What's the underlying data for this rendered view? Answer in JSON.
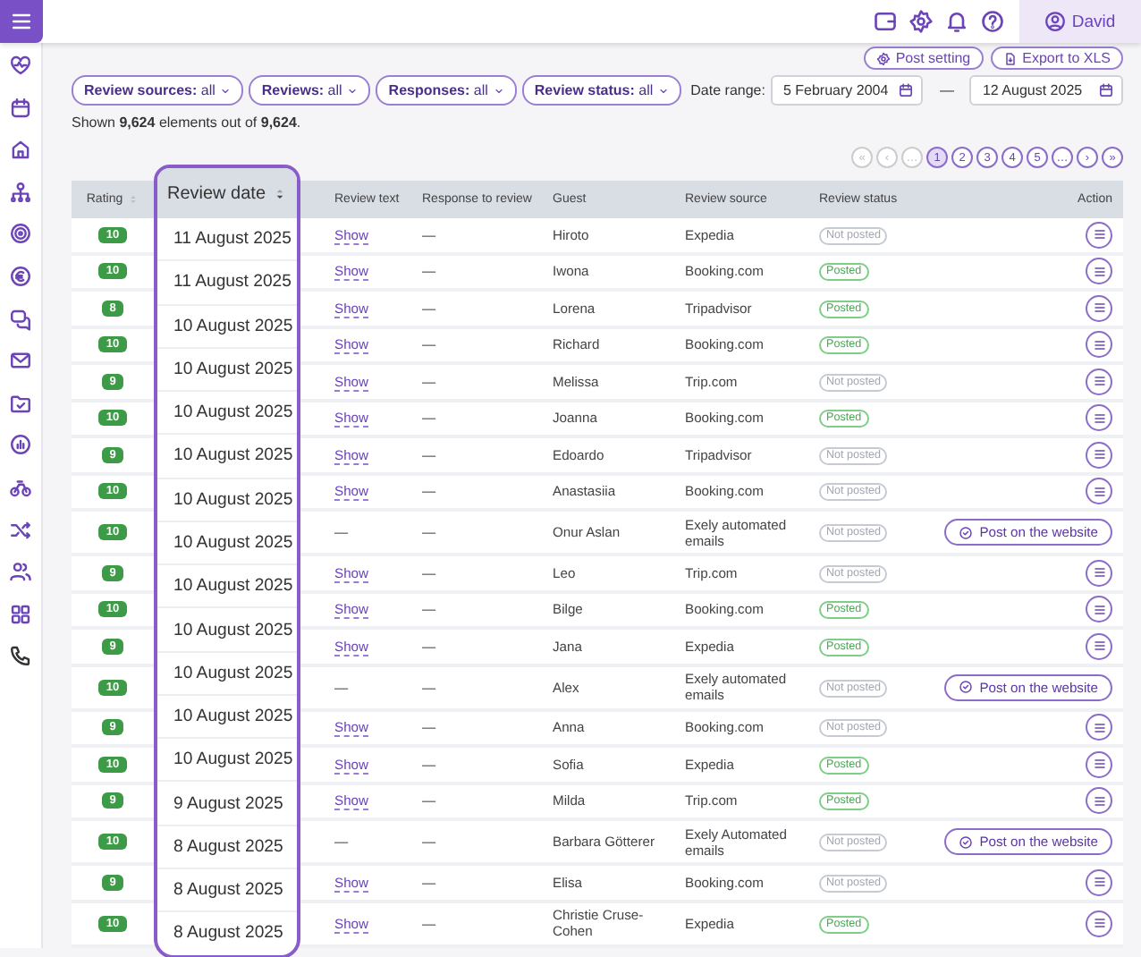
{
  "top_bar": {
    "user": "David"
  },
  "toolbar": {
    "buttons": [
      {
        "label": "Post setting",
        "kind": "settings"
      },
      {
        "label": "Export to XLS",
        "kind": "export"
      }
    ]
  },
  "filters": [
    {
      "label": "**Review sources:** all"
    },
    {
      "label": "**Reviews:** all"
    },
    {
      "label": "**Responses:** all"
    },
    {
      "label": "**Review status:** all"
    }
  ],
  "date_range": {
    "label": "Date range:",
    "from": "5 February 2004",
    "separator": "—",
    "to": "12 August 2025"
  },
  "summary": "Shown **9,624** elements out of **9,624**.",
  "pagination": [
    {
      "label": "«",
      "disabled": true,
      "selected": false
    },
    {
      "label": "‹",
      "disabled": true,
      "selected": false
    },
    {
      "label": "…",
      "disabled": true,
      "selected": false
    },
    {
      "label": "1",
      "disabled": false,
      "selected": true
    },
    {
      "label": "2",
      "disabled": false,
      "selected": false
    },
    {
      "label": "3",
      "disabled": false,
      "selected": false
    },
    {
      "label": "4",
      "disabled": false,
      "selected": false
    },
    {
      "label": "5",
      "disabled": false,
      "selected": false
    },
    {
      "label": "…",
      "disabled": false,
      "selected": false
    },
    {
      "label": "›",
      "disabled": false,
      "selected": false
    },
    {
      "label": "»",
      "disabled": false,
      "selected": false
    }
  ],
  "table": {
    "columns": [
      "Rating",
      "Review text",
      "Response to review",
      "Guest",
      "Review source",
      "Review status",
      "Action"
    ],
    "date_column": {
      "title": "Review date",
      "dates": [
        "11 August 2025",
        "11 August 2025",
        "10 August 2025",
        "10 August 2025",
        "10 August 2025",
        "10 August 2025",
        "10 August 2025",
        "10 August 2025",
        "10 August 2025",
        "10 August 2025",
        "10 August 2025",
        "10 August 2025",
        "10 August 2025",
        "9 August 2025",
        "8 August 2025",
        "8 August 2025",
        "8 August 2025"
      ]
    },
    "rows": [
      {
        "rating": "10",
        "review_text": {
          "kind": "link",
          "text": "Show"
        },
        "response": "—",
        "guest": "Hiroto",
        "source": "Expedia",
        "status": {
          "text": "Not posted",
          "posted": false
        },
        "action": {
          "kind": "menu"
        }
      },
      {
        "rating": "10",
        "review_text": {
          "kind": "link",
          "text": "Show"
        },
        "response": "—",
        "guest": "Iwona",
        "source": "Booking.com",
        "status": {
          "text": "Posted",
          "posted": true
        },
        "action": {
          "kind": "menu"
        }
      },
      {
        "rating": "8",
        "review_text": {
          "kind": "link",
          "text": "Show"
        },
        "response": "—",
        "guest": "Lorena",
        "source": "Tripadvisor",
        "status": {
          "text": "Posted",
          "posted": true
        },
        "action": {
          "kind": "menu"
        }
      },
      {
        "rating": "10",
        "review_text": {
          "kind": "link",
          "text": "Show"
        },
        "response": "—",
        "guest": "Richard",
        "source": "Booking.com",
        "status": {
          "text": "Posted",
          "posted": true
        },
        "action": {
          "kind": "menu"
        }
      },
      {
        "rating": "9",
        "review_text": {
          "kind": "link",
          "text": "Show"
        },
        "response": "—",
        "guest": "Melissa",
        "source": "Trip.com",
        "status": {
          "text": "Not posted",
          "posted": false
        },
        "action": {
          "kind": "menu"
        }
      },
      {
        "rating": "10",
        "review_text": {
          "kind": "link",
          "text": "Show"
        },
        "response": "—",
        "guest": "Joanna",
        "source": "Booking.com",
        "status": {
          "text": "Posted",
          "posted": true
        },
        "action": {
          "kind": "menu"
        }
      },
      {
        "rating": "9",
        "review_text": {
          "kind": "link",
          "text": "Show"
        },
        "response": "—",
        "guest": "Edoardo",
        "source": "Tripadvisor",
        "status": {
          "text": "Not posted",
          "posted": false
        },
        "action": {
          "kind": "menu"
        }
      },
      {
        "rating": "10",
        "review_text": {
          "kind": "link",
          "text": "Show"
        },
        "response": "—",
        "guest": "Anastasiia",
        "source": "Booking.com",
        "status": {
          "text": "Not posted",
          "posted": false
        },
        "action": {
          "kind": "menu"
        }
      },
      {
        "rating": "10",
        "review_text": {
          "kind": "text",
          "text": "—"
        },
        "response": "—",
        "guest": "Onur Aslan",
        "source": "Exely automated emails",
        "status": {
          "text": "Not posted",
          "posted": false
        },
        "action": {
          "kind": "post",
          "label": "Post on the website"
        }
      },
      {
        "rating": "9",
        "review_text": {
          "kind": "link",
          "text": "Show"
        },
        "response": "—",
        "guest": "Leo",
        "source": "Trip.com",
        "status": {
          "text": "Not posted",
          "posted": false
        },
        "action": {
          "kind": "menu"
        }
      },
      {
        "rating": "10",
        "review_text": {
          "kind": "link",
          "text": "Show"
        },
        "response": "—",
        "guest": "Bilge",
        "source": "Booking.com",
        "status": {
          "text": "Posted",
          "posted": true
        },
        "action": {
          "kind": "menu"
        }
      },
      {
        "rating": "9",
        "review_text": {
          "kind": "link",
          "text": "Show"
        },
        "response": "—",
        "guest": "Jana",
        "source": "Expedia",
        "status": {
          "text": "Posted",
          "posted": true
        },
        "action": {
          "kind": "menu"
        }
      },
      {
        "rating": "10",
        "review_text": {
          "kind": "text",
          "text": "—"
        },
        "response": "—",
        "guest": "Alex",
        "source": "Exely automated emails",
        "status": {
          "text": "Not posted",
          "posted": false
        },
        "action": {
          "kind": "post",
          "label": "Post on the website"
        }
      },
      {
        "rating": "9",
        "review_text": {
          "kind": "link",
          "text": "Show"
        },
        "response": "—",
        "guest": "Anna",
        "source": "Booking.com",
        "status": {
          "text": "Not posted",
          "posted": false
        },
        "action": {
          "kind": "menu"
        }
      },
      {
        "rating": "10",
        "review_text": {
          "kind": "link",
          "text": "Show"
        },
        "response": "—",
        "guest": "Sofia",
        "source": "Expedia",
        "status": {
          "text": "Posted",
          "posted": true
        },
        "action": {
          "kind": "menu"
        }
      },
      {
        "rating": "9",
        "review_text": {
          "kind": "link",
          "text": "Show"
        },
        "response": "—",
        "guest": "Milda",
        "source": "Trip.com",
        "status": {
          "text": "Posted",
          "posted": true
        },
        "action": {
          "kind": "menu"
        }
      },
      {
        "rating": "10",
        "review_text": {
          "kind": "text",
          "text": "—"
        },
        "response": "—",
        "guest": "Barbara Götterer",
        "source": "Exely Automated emails",
        "status": {
          "text": "Not posted",
          "posted": false
        },
        "action": {
          "kind": "post",
          "label": "Post on the website"
        }
      },
      {
        "rating": "9",
        "review_text": {
          "kind": "link",
          "text": "Show"
        },
        "response": "—",
        "guest": "Elisa",
        "source": "Booking.com",
        "status": {
          "text": "Not posted",
          "posted": false
        },
        "action": {
          "kind": "menu"
        }
      },
      {
        "rating": "10",
        "review_text": {
          "kind": "link",
          "text": "Show"
        },
        "response": "—",
        "guest": "Christie Cruse-Cohen",
        "source": "Expedia",
        "status": {
          "text": "Posted",
          "posted": true
        },
        "action": {
          "kind": "menu"
        }
      }
    ]
  }
}
